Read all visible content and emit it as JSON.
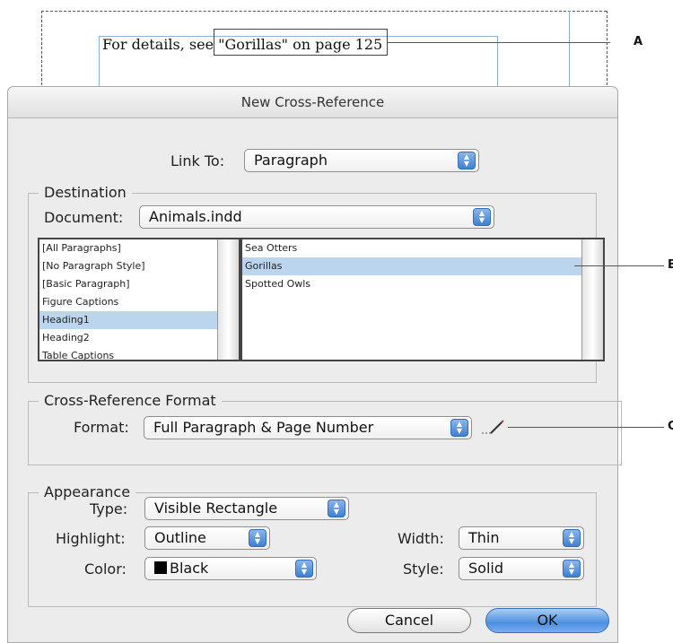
{
  "document": {
    "text_before": "For details, see ",
    "cross_reference": "\"Gorillas\" on page 125"
  },
  "callouts": {
    "a": "A",
    "b": "B",
    "c": "C"
  },
  "dialog": {
    "title": "New Cross-Reference",
    "link_to": {
      "label": "Link To:",
      "value": "Paragraph"
    },
    "destination": {
      "group_title": "Destination",
      "document_label": "Document:",
      "document_value": "Animals.indd",
      "styles": [
        "[All Paragraphs]",
        "[No Paragraph Style]",
        "[Basic Paragraph]",
        "Figure Captions",
        "Heading1",
        "Heading2",
        "Table Captions"
      ],
      "selected_style": "Heading1",
      "paragraphs": [
        "Sea Otters",
        "Gorillas",
        "Spotted Owls"
      ],
      "selected_paragraph": "Gorillas"
    },
    "format": {
      "group_title": "Cross-Reference Format",
      "label": "Format:",
      "value": "Full Paragraph & Page Number"
    },
    "appearance": {
      "group_title": "Appearance",
      "type_label": "Type:",
      "type_value": "Visible Rectangle",
      "highlight_label": "Highlight:",
      "highlight_value": "Outline",
      "color_label": "Color:",
      "color_value": "Black",
      "width_label": "Width:",
      "width_value": "Thin",
      "style_label": "Style:",
      "style_value": "Solid"
    },
    "buttons": {
      "cancel": "Cancel",
      "ok": "OK"
    }
  },
  "colors": {
    "accent": "#4d90e0",
    "selection": "#bcd5ef",
    "swatch_black": "#000000"
  }
}
